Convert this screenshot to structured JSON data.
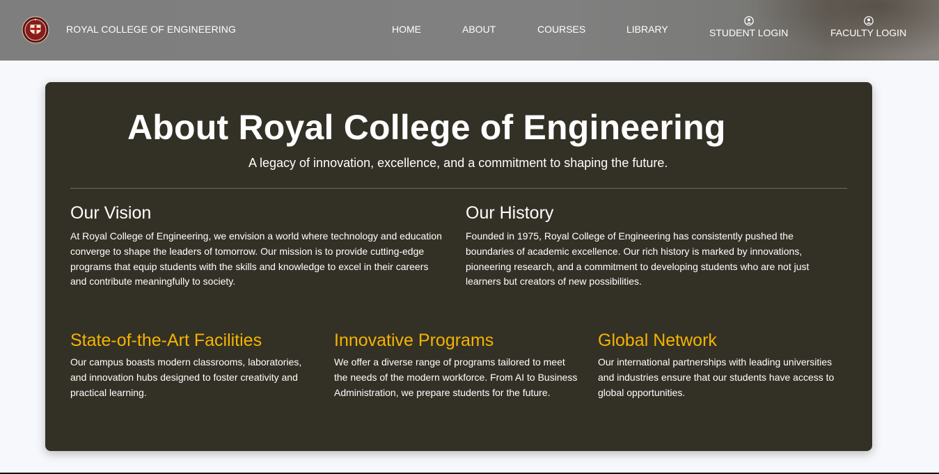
{
  "navbar": {
    "brand": "ROYAL COLLEGE OF ENGINEERING",
    "logo_icon": "college-crest-icon",
    "links": [
      {
        "label": "HOME"
      },
      {
        "label": "ABOUT"
      },
      {
        "label": "COURSES"
      },
      {
        "label": "LIBRARY"
      }
    ],
    "student_login": {
      "label": "STUDENT LOGIN",
      "icon": "user-circle-icon"
    },
    "faculty_login": {
      "label": "FACULTY LOGIN",
      "icon": "user-circle-icon"
    }
  },
  "about": {
    "title": "About Royal College of Engineering",
    "tagline": "A legacy of innovation, excellence, and a commitment to shaping the future.",
    "vision": {
      "heading": "Our Vision",
      "text": "At Royal College of Engineering, we envision a world where technology and education converge to shape the leaders of tomorrow. Our mission is to provide cutting-edge programs that equip students with the skills and knowledge to excel in their careers and contribute meaningfully to society."
    },
    "history": {
      "heading": "Our History",
      "text": "Founded in 1975, Royal College of Engineering has consistently pushed the boundaries of academic excellence. Our rich history is marked by innovations, pioneering research, and a commitment to developing students who are not just learners but creators of new possibilities."
    },
    "features": [
      {
        "heading": "State-of-the-Art Facilities",
        "text": "Our campus boasts modern classrooms, laboratories, and innovation hubs designed to foster creativity and practical learning."
      },
      {
        "heading": "Innovative Programs",
        "text": "We offer a diverse range of programs tailored to meet the needs of the modern workforce. From AI to Business Administration, we prepare students for the future."
      },
      {
        "heading": "Global Network",
        "text": "Our international partnerships with leading universities and industries ensure that our students have access to global opportunities."
      }
    ]
  },
  "colors": {
    "navbar": "#808080",
    "card_background": "#333126",
    "feature_heading": "#f5b301",
    "text": "#ffffff",
    "page_background": "#f6f8fb"
  }
}
